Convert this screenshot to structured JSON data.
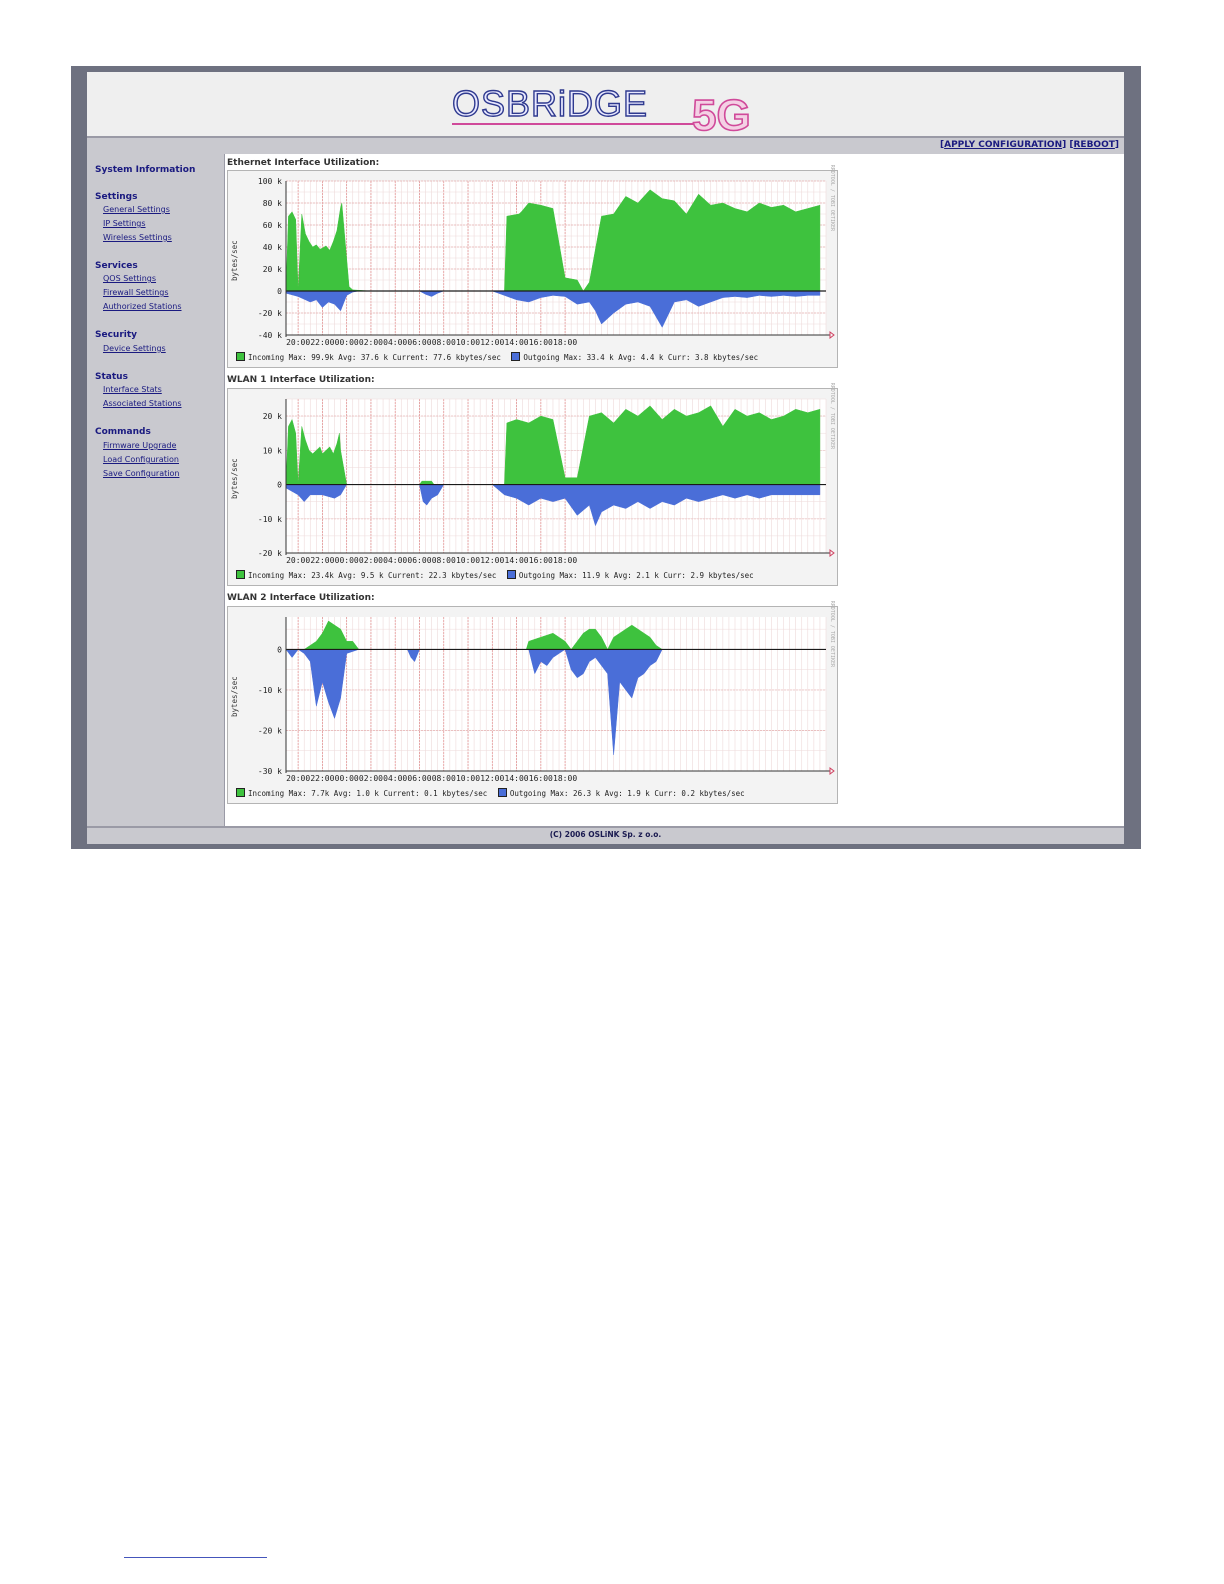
{
  "header": {
    "logo_text": "OSBRiDGE",
    "logo_suffix": "5G",
    "apply_label": "APPLY CONFIGURATION",
    "reboot_label": "REBOOT"
  },
  "sidebar": {
    "system_information": "System Information",
    "sections": [
      {
        "title": "Settings",
        "items": [
          "General Settings",
          "IP Settings",
          "Wireless Settings"
        ]
      },
      {
        "title": "Services",
        "items": [
          "QOS Settings",
          "Firewall Settings",
          "Authorized Stations"
        ]
      },
      {
        "title": "Security",
        "items": [
          "Device Settings"
        ]
      },
      {
        "title": "Status",
        "items": [
          "Interface Stats",
          "Associated Stations"
        ]
      },
      {
        "title": "Commands",
        "items": [
          "Firmware Upgrade",
          "Load Configuration",
          "Save Configuration"
        ]
      }
    ]
  },
  "footer": {
    "copyright": "(C) 2006 OSLiNK Sp. z o.o."
  },
  "colors": {
    "incoming": "#3ec23e",
    "outgoing": "#4a6ed8",
    "grid": "#e08a8a",
    "frame": "#6e7180",
    "sidebar": "#c9c9cf"
  },
  "chart_data": [
    {
      "type": "area",
      "title": "Ethernet Interface Utilization:",
      "ylabel": "bytes/sec",
      "ylim": [
        -40,
        100
      ],
      "yticks": [
        "100 k",
        "80 k",
        "60 k",
        "40 k",
        "20 k",
        "0",
        "-20 k",
        "-40 k"
      ],
      "xticks": [
        "20:00",
        "22:00",
        "00:00",
        "02:00",
        "04:00",
        "06:00",
        "08:00",
        "10:00",
        "12:00",
        "14:00",
        "16:00",
        "18:00"
      ],
      "rrd_label": "RRDTOOL / TOBI OETIKER",
      "legend": {
        "incoming": "Incoming  Max:  99.9k  Avg:  37.6 k  Current:  77.6 kbytes/sec",
        "outgoing": "Outgoing  Max:  33.4 k  Avg:   4.4 k  Curr:  3.8 kbytes/sec"
      },
      "series": [
        {
          "name": "Incoming",
          "x": [
            19.0,
            19.2,
            19.5,
            19.8,
            20.0,
            20.3,
            20.6,
            20.9,
            21.2,
            21.5,
            21.8,
            22.0,
            22.3,
            22.6,
            22.9,
            23.2,
            23.5,
            23.6,
            24.2,
            24.5,
            26,
            28,
            30,
            31.6,
            31.7,
            32,
            33,
            34,
            35,
            36,
            37,
            37.2,
            38.2,
            38.4,
            39,
            40,
            41,
            42,
            43,
            44,
            45,
            46,
            47,
            48,
            49,
            50,
            51,
            52,
            53,
            54,
            55,
            56,
            57,
            58,
            59,
            60,
            61,
            62,
            63,
            43.5
          ],
          "values": [
            0,
            68,
            72,
            65,
            0,
            70,
            52,
            45,
            40,
            42,
            38,
            39,
            41,
            37,
            45,
            55,
            76,
            80,
            4,
            1,
            0,
            0,
            0,
            0,
            0,
            0,
            0,
            0,
            0,
            0,
            0,
            68,
            70,
            72,
            80,
            78,
            75,
            12,
            10,
            8,
            68,
            70,
            86,
            80,
            92,
            84,
            82,
            70,
            88,
            78,
            80,
            75,
            72,
            80,
            76,
            78,
            72,
            75,
            78,
            0
          ]
        },
        {
          "name": "Outgoing",
          "x": [
            19.0,
            20.0,
            21.0,
            21.5,
            22.0,
            22.5,
            23.0,
            23.5,
            24.0,
            24.5,
            25,
            30,
            30.5,
            31,
            31.5,
            32,
            36,
            37,
            38,
            39,
            40,
            41,
            42,
            43,
            44,
            44.5,
            45,
            46,
            47,
            48,
            49,
            50,
            51,
            52,
            53,
            54,
            55,
            56,
            57,
            58,
            59,
            60,
            61,
            62,
            63
          ],
          "values": [
            -2,
            -5,
            -10,
            -8,
            -15,
            -10,
            -12,
            -18,
            -4,
            -1,
            0,
            0,
            -3,
            -5,
            -2,
            0,
            0,
            -4,
            -8,
            -10,
            -6,
            -4,
            -5,
            -12,
            -10,
            -18,
            -30,
            -20,
            -12,
            -10,
            -14,
            -33,
            -10,
            -8,
            -14,
            -10,
            -6,
            -5,
            -6,
            -4,
            -5,
            -4,
            -5,
            -4,
            -4
          ]
        }
      ]
    },
    {
      "type": "area",
      "title": "WLAN 1 Interface Utilization:",
      "ylabel": "bytes/sec",
      "ylim": [
        -20,
        25
      ],
      "yticks": [
        "20 k",
        "10 k",
        "0",
        "-10 k",
        "-20 k"
      ],
      "xticks": [
        "20:00",
        "22:00",
        "00:00",
        "02:00",
        "04:00",
        "06:00",
        "08:00",
        "10:00",
        "12:00",
        "14:00",
        "16:00",
        "18:00"
      ],
      "rrd_label": "RRDTOOL / TOBI OETIKER",
      "legend": {
        "incoming": "Incoming  Max:  23.4k  Avg:   9.5 k  Current:  22.3 kbytes/sec",
        "outgoing": "Outgoing  Max:  11.9 k  Avg:   2.1 k  Curr:  2.9 kbytes/sec"
      },
      "series": [
        {
          "name": "Incoming",
          "x": [
            19.0,
            19.2,
            19.5,
            19.8,
            20.0,
            20.3,
            20.6,
            20.9,
            21.2,
            21.5,
            21.8,
            22.0,
            22.3,
            22.6,
            22.9,
            23.2,
            23.4,
            23.5,
            24,
            30,
            30.2,
            30.5,
            31,
            31.2,
            32,
            36,
            37,
            37.2,
            38,
            39,
            40,
            41,
            42,
            43,
            44,
            45,
            46,
            47,
            48,
            49,
            50,
            51,
            52,
            53,
            54,
            55,
            56,
            57,
            58,
            59,
            60,
            61,
            62,
            63
          ],
          "values": [
            0,
            17,
            19,
            15,
            0,
            17,
            13,
            10,
            9,
            10,
            11,
            9,
            10,
            11,
            9,
            12,
            15,
            10,
            0,
            0,
            1,
            1,
            1,
            0,
            0,
            0,
            0,
            18,
            19,
            18,
            20,
            19,
            2,
            2,
            20,
            21,
            18,
            22,
            20,
            23,
            19,
            22,
            20,
            21,
            23,
            17,
            22,
            20,
            21,
            19,
            20,
            22,
            21,
            22
          ]
        },
        {
          "name": "Outgoing",
          "x": [
            19.0,
            20.0,
            20.5,
            21.0,
            22.0,
            23.0,
            23.5,
            24,
            25,
            30,
            30.3,
            30.6,
            31,
            31.5,
            32,
            36,
            37,
            38,
            39,
            40,
            41,
            42,
            43,
            44,
            44.5,
            45,
            46,
            47,
            48,
            49,
            50,
            51,
            52,
            53,
            54,
            55,
            56,
            57,
            58,
            59,
            60,
            61,
            62,
            63
          ],
          "values": [
            -1,
            -3,
            -5,
            -3,
            -3,
            -4,
            -3,
            0,
            0,
            0,
            -5,
            -6,
            -4,
            -3,
            0,
            0,
            -3,
            -4,
            -6,
            -4,
            -5,
            -4,
            -9,
            -6,
            -12,
            -8,
            -6,
            -7,
            -5,
            -7,
            -5,
            -6,
            -4,
            -5,
            -4,
            -3,
            -4,
            -3,
            -4,
            -3,
            -3,
            -3,
            -3,
            -3
          ]
        }
      ]
    },
    {
      "type": "area",
      "title": "WLAN 2 Interface Utilization:",
      "ylabel": "bytes/sec",
      "ylim": [
        -30,
        8
      ],
      "yticks": [
        "0",
        "-10 k",
        "-20 k",
        "-30 k"
      ],
      "xticks": [
        "20:00",
        "22:00",
        "00:00",
        "02:00",
        "04:00",
        "06:00",
        "08:00",
        "10:00",
        "12:00",
        "14:00",
        "16:00",
        "18:00"
      ],
      "rrd_label": "RRDTOOL / TOBI OETIKER",
      "legend": {
        "incoming": "Incoming  Max:   7.7k  Avg:   1.0 k  Current:   0.1 kbytes/sec",
        "outgoing": "Outgoing  Max:  26.3 k  Avg:   1.9 k  Curr:  0.2 kbytes/sec"
      },
      "series": [
        {
          "name": "Incoming",
          "x": [
            19.0,
            20.5,
            21.0,
            21.5,
            22.0,
            22.5,
            23.0,
            23.5,
            24.0,
            24.5,
            25,
            38.8,
            39,
            40,
            41,
            42,
            42.5,
            43,
            43.5,
            44,
            44.5,
            45,
            45.5,
            46,
            46.5,
            47,
            47.5,
            48,
            48.5,
            49,
            49.5,
            50
          ],
          "values": [
            0,
            0,
            1,
            2,
            4,
            7,
            6,
            5,
            2,
            2,
            0,
            0,
            2,
            3,
            4,
            2,
            0,
            2,
            4,
            5,
            5,
            3,
            0,
            3,
            4,
            5,
            6,
            5,
            4,
            3,
            1,
            0
          ]
        },
        {
          "name": "Outgoing",
          "x": [
            19.0,
            19.5,
            20.0,
            20.5,
            21.0,
            21.5,
            22.0,
            22.5,
            23.0,
            23.5,
            24.0,
            25,
            29,
            29.3,
            29.6,
            30,
            39,
            39.5,
            40,
            40.5,
            41,
            42,
            42.5,
            43,
            43.5,
            44,
            44.5,
            45,
            45.5,
            46,
            46.5,
            47,
            47.5,
            48,
            48.5,
            49,
            49.5,
            50
          ],
          "values": [
            0,
            -2,
            0,
            -1,
            -3,
            -14,
            -8,
            -13,
            -17,
            -12,
            -1,
            0,
            0,
            -2,
            -3,
            0,
            0,
            -6,
            -3,
            -4,
            -2,
            0,
            -5,
            -7,
            -6,
            -3,
            -2,
            -4,
            -6,
            -26,
            -8,
            -10,
            -12,
            -7,
            -6,
            -4,
            -3,
            0
          ]
        }
      ]
    }
  ]
}
